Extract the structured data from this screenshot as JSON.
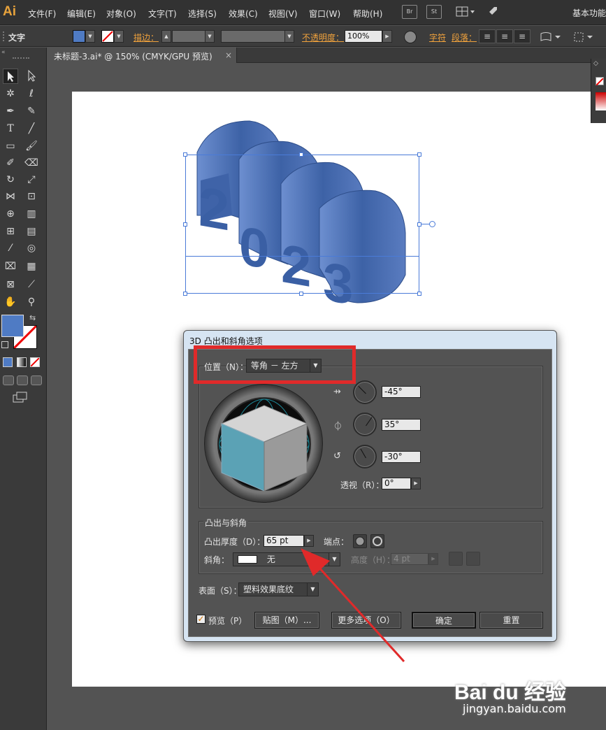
{
  "menubar": {
    "logo": "Ai",
    "items": [
      "文件(F)",
      "编辑(E)",
      "对象(O)",
      "文字(T)",
      "选择(S)",
      "效果(C)",
      "视图(V)",
      "窗口(W)",
      "帮助(H)"
    ],
    "br": "Br",
    "st": "St",
    "workspace": "基本功能"
  },
  "controlbar": {
    "tool_label": "文字",
    "stroke_label": "描边：",
    "opacity_label": "不透明度：",
    "opacity_value": "100%",
    "char_label": "字符",
    "para_label": "段落："
  },
  "tab": {
    "title": "未标题-3.ai* @ 150% (CMYK/GPU 预览)",
    "close": "×"
  },
  "colors": {
    "fill": "#4f7bc4",
    "text3d": "#4a6fb0",
    "accent": "#f0a23c",
    "highlight": "#e02a2a"
  },
  "artwork": {
    "text": "2023"
  },
  "dialog": {
    "title": "3D 凸出和斜角选项",
    "position_label": "位置（N）：",
    "position_value": "等角 － 左方",
    "x_rotation": "-45°",
    "y_rotation": "35°",
    "z_rotation": "-30°",
    "perspective_label": "透视（R）：",
    "perspective_value": "0°",
    "extrude_section": "凸出与斜角",
    "extrude_depth_label": "凸出厚度（D）：",
    "extrude_depth_value": "65 pt",
    "cap_label": "端点：",
    "bevel_label": "斜角：",
    "bevel_value": "无",
    "height_label": "高度（H）：",
    "height_value": "4 pt",
    "surface_label": "表面（S）：",
    "surface_value": "塑料效果底纹",
    "preview_label": "预览（P）",
    "map_button": "贴图（M）...",
    "more_button": "更多选项（O）",
    "ok_button": "确定",
    "reset_button": "重置"
  },
  "watermark": {
    "brand": "Bai du 经验",
    "url": "jingyan.baidu.com"
  }
}
